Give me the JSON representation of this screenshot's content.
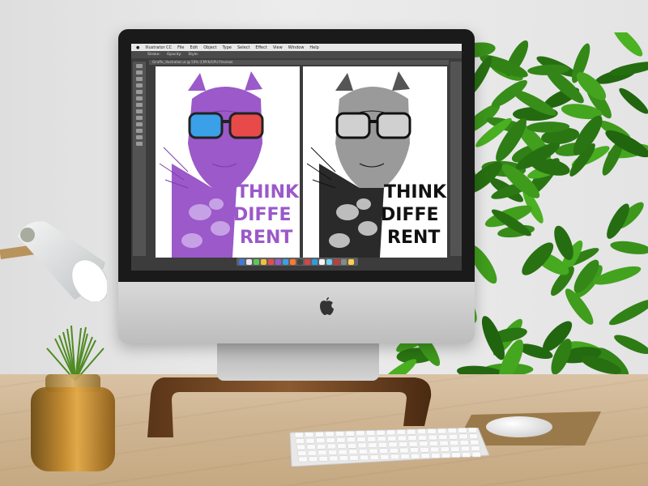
{
  "scene": "Desk setup with iMac displaying vector illustration in design app",
  "app": {
    "menu": [
      "Illustrator CC",
      "File",
      "Edit",
      "Object",
      "Type",
      "Select",
      "Effect",
      "View",
      "Window",
      "Help"
    ],
    "document_tab": "Giraffe_illustration.ai @ 50% (CMYK/GPU Preview)",
    "options": [
      "Stroke:",
      "Opacity:",
      "Style:"
    ]
  },
  "artwork": {
    "headline_lines": [
      "THINK",
      "DIFFE",
      "RENT"
    ],
    "colors": {
      "purple": "#9b59c9",
      "light_purple": "#c7a1e6",
      "blue_lens": "#3aa0e8",
      "red_lens": "#e84a4a",
      "black": "#111111"
    }
  },
  "dock_colors": [
    "#3b7be0",
    "#e8e8e8",
    "#5ac85a",
    "#f0c23a",
    "#e84a4a",
    "#9b59c9",
    "#3aa0e8",
    "#ff7a2a",
    "#444444",
    "#d64545",
    "#2e9be0",
    "#f4f4f4",
    "#6ecff0",
    "#c23b3b",
    "#888888",
    "#ffd24a"
  ]
}
